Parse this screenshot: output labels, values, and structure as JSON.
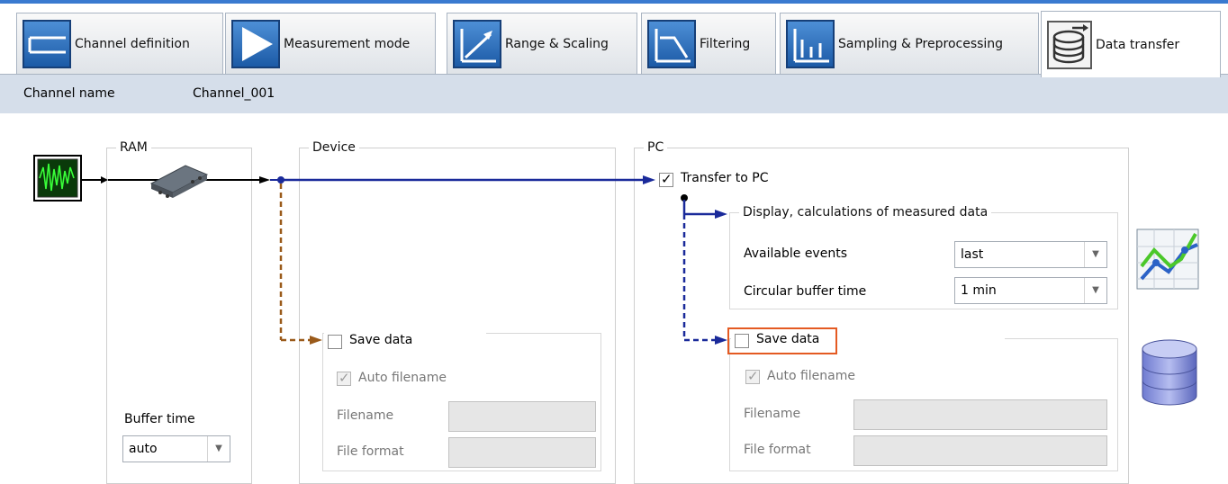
{
  "tabs": [
    {
      "label": "Channel definition",
      "icon": "channel-definition-icon"
    },
    {
      "label": "Measurement mode",
      "icon": "play-icon"
    },
    {
      "label": "Range & Scaling",
      "icon": "scaling-icon"
    },
    {
      "label": "Filtering",
      "icon": "filter-icon"
    },
    {
      "label": "Sampling & Preprocessing",
      "icon": "sampling-icon"
    },
    {
      "label": "Data transfer",
      "icon": "database-icon",
      "active": true
    }
  ],
  "channel": {
    "label": "Channel name",
    "value": "Channel_001"
  },
  "ram": {
    "title": "RAM",
    "buffer_label": "Buffer time",
    "buffer_value": "auto"
  },
  "device": {
    "title": "Device",
    "save_label": "Save data",
    "auto_filename_label": "Auto filename",
    "filename_label": "Filename",
    "format_label": "File format"
  },
  "pc": {
    "title": "PC",
    "transfer_label": "Transfer to PC",
    "display_group_title": "Display, calculations of measured data",
    "events_label": "Available events",
    "events_value": "last",
    "circular_label": "Circular buffer time",
    "circular_value": "1 min",
    "save_label": "Save data",
    "auto_filename_label": "Auto filename",
    "filename_label": "Filename",
    "format_label": "File format"
  },
  "colors": {
    "accent_line": "#3a7ad0",
    "bus_blue": "#1a2a9a",
    "device_link": "#9a5a1a",
    "highlight": "#e45a22"
  }
}
